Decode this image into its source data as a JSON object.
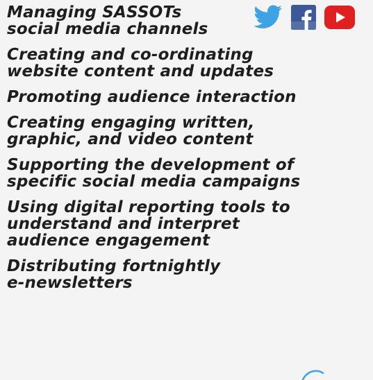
{
  "items": [
    {
      "lines": [
        "Managing SASSOTs",
        "social media channels"
      ]
    },
    {
      "lines": [
        "Creating and co-ordinating",
        "website content and updates"
      ]
    },
    {
      "lines": [
        "Promoting audience interaction"
      ]
    },
    {
      "lines": [
        "Creating engaging written,",
        "graphic, and video content"
      ]
    },
    {
      "lines": [
        "Supporting the development of",
        "specific social media campaigns"
      ]
    },
    {
      "lines": [
        "Using digital reporting tools to",
        "understand and interpret",
        "audience engagement"
      ]
    },
    {
      "lines": [
        "Distributing fortnightly",
        "e-newsletters"
      ]
    }
  ],
  "icons": [
    {
      "name": "twitter-icon",
      "color": "#3ea3e4"
    },
    {
      "name": "facebook-icon",
      "color": "#3b5998"
    },
    {
      "name": "youtube-icon",
      "color": "#e02020"
    }
  ]
}
